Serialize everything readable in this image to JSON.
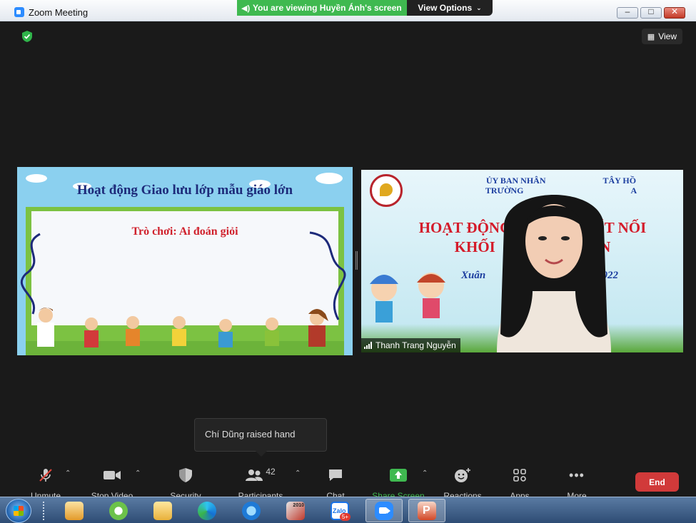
{
  "window": {
    "title": "Zoom Meeting",
    "share_banner": "You are viewing Huyền Ánh's screen",
    "view_options": "View Options"
  },
  "meeting": {
    "view_label": "View",
    "left_tile": {
      "slide_title": "Hoạt động Giao lưu lớp mẫu giáo lớn",
      "game_title": "Trò chơi: Ai đoán giỏi"
    },
    "right_tile": {
      "line1": "ỦY BAN NHÂN",
      "line1b": "TÂY HỒ",
      "line2": "TRƯỜNG",
      "line2b": "A",
      "big1a": "HOẠT ĐỘNG",
      "big1b": "KẾT NỐI",
      "big2a": "KHỐI",
      "big2b": "ỚN",
      "date_a": "Xuân",
      "date_b": "2022",
      "participant_name": "Thanh Trang Nguyễn"
    },
    "toast": "Chí Dũng raised hand"
  },
  "toolbar": {
    "unmute": "Unmute",
    "stop_video": "Stop Video",
    "security": "Security",
    "participants": "Participants",
    "participants_count": "42",
    "chat": "Chat",
    "share_screen": "Share Screen",
    "reactions": "Reactions",
    "apps": "Apps",
    "more": "More",
    "end": "End"
  },
  "taskbar": {
    "zalo_badge": "5+",
    "zalo_text": "Zalo",
    "autocad_text": "2010"
  },
  "colors": {
    "share_green": "#3fb950",
    "end_red": "#d13a3a",
    "zoom_blue": "#2d8cff"
  }
}
